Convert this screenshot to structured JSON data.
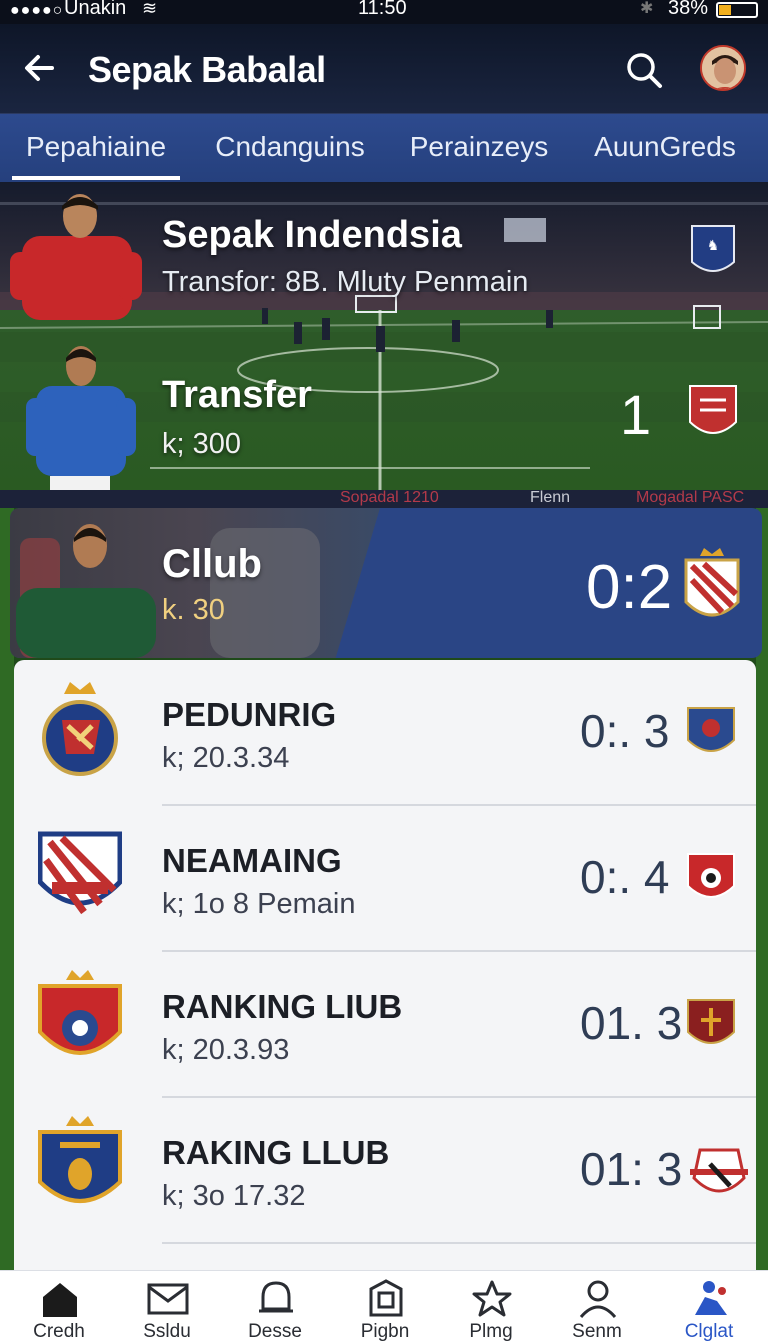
{
  "status_bar": {
    "carrier": "Unakin",
    "time": "11:50",
    "battery": "38%"
  },
  "header": {
    "title": "Sepak Babalal",
    "back_icon": "arrow-left-icon",
    "search_icon": "search-icon"
  },
  "tabs": [
    {
      "label": "Pepahiaine",
      "active": true
    },
    {
      "label": "Cndanguins",
      "active": false
    },
    {
      "label": "Perainzeys",
      "active": false
    },
    {
      "label": "AuunGreds",
      "active": false
    }
  ],
  "hero": {
    "title": "Sepak Indendsia",
    "subtitle": "Transfor: 8B. Mluty Penmain",
    "label2": "Transfer",
    "sub2": "k; 300",
    "score": "1"
  },
  "strip": {
    "texts": [
      "Sopadal 1210",
      "Flenn",
      "Mogadal PASC"
    ]
  },
  "featured": {
    "label": "Cllub",
    "sub": "k. 30",
    "score": "0:2"
  },
  "rows": [
    {
      "name": "PEDUNRIG",
      "meta": "k; 20.3.34",
      "score": "0:. 3"
    },
    {
      "name": "NEAMAING",
      "meta": "k; 1o 8 Pemain",
      "score": "0:. 4"
    },
    {
      "name": "RANKING LIUB",
      "meta": "k; 20.3.93",
      "score": "01. 3"
    },
    {
      "name": "RAKING LLUB",
      "meta": "k; 3o 17.32",
      "score": "01: 3"
    }
  ],
  "bottom_nav": [
    {
      "label": "Credh",
      "icon": "home-icon",
      "active": false
    },
    {
      "label": "Ssldu",
      "icon": "mail-icon",
      "active": false
    },
    {
      "label": "Desse",
      "icon": "bell-icon",
      "active": false
    },
    {
      "label": "Pigbn",
      "icon": "shield-icon",
      "active": false
    },
    {
      "label": "Plmg",
      "icon": "star-icon",
      "active": false
    },
    {
      "label": "Senm",
      "icon": "person-icon",
      "active": false
    },
    {
      "label": "Clglat",
      "icon": "player-icon",
      "active": true
    }
  ],
  "colors": {
    "header_bg": "#0e1628",
    "tab_bg": "#2d4a8e",
    "featured_bg": "#2a4585",
    "list_bg": "#f4f5f7",
    "score_text": "#2f3d55",
    "active_nav": "#2a56c6"
  }
}
